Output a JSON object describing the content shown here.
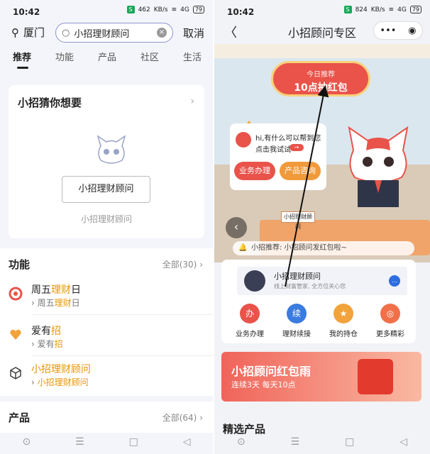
{
  "left": {
    "status": {
      "time": "10:42",
      "data_rate": "462",
      "data_unit": "KB/s",
      "signal": "4G",
      "battery": "79"
    },
    "location": "厦门",
    "search": {
      "value": "小招理财顾问",
      "clear": "×"
    },
    "cancel": "取消",
    "tabs": [
      "推荐",
      "功能",
      "产品",
      "社区",
      "生活"
    ],
    "guess": {
      "title": "小招猜你想要",
      "chevron": "›",
      "button": "小招理财顾问",
      "subtitle": "小招理财顾问"
    },
    "functions": {
      "title": "功能",
      "all": "全部(30)",
      "items": [
        {
          "name_pre": "周五",
          "name_hl": "理财",
          "name_post": "日",
          "sub_pre": "› 周五",
          "sub_hl": "理财",
          "sub_post": "日"
        },
        {
          "name_pre": "爱有",
          "name_hl": "招",
          "name_post": "",
          "sub_pre": "› 爱有",
          "sub_hl": "招",
          "sub_post": ""
        },
        {
          "name_pre": "",
          "name_hl": "小招理财顾问",
          "name_post": "",
          "sub_pre": "› ",
          "sub_hl": "小招理财顾问",
          "sub_post": ""
        }
      ]
    },
    "products": {
      "title": "产品",
      "all": "全部(64)"
    }
  },
  "right": {
    "status": {
      "time": "10:42",
      "data_rate": "824",
      "data_unit": "KB/s",
      "signal": "4G",
      "battery": "79"
    },
    "back": "〈",
    "title": "小招顾问专区",
    "menu": "•••",
    "close": "◉",
    "badge": {
      "top": "今日推荐",
      "main": "10点抽红包"
    },
    "bubble": {
      "greeting": "hi,有什么可以帮到您",
      "try": "点击我试试",
      "btn1": "业务办理",
      "btn2": "产品咨询"
    },
    "plaque": "小招理财顾问",
    "notice": "小招推荐: 小招顾问发红包啦~",
    "advisor": {
      "name": "小招理财顾问",
      "desc": "线上财富管家, 全方位关心您"
    },
    "quick": [
      {
        "label": "业务办理",
        "color": "#e9534a",
        "glyph": "办"
      },
      {
        "label": "理财续接",
        "color": "#3a7be0",
        "glyph": "续"
      },
      {
        "label": "我的持仓",
        "color": "#f2a33c",
        "glyph": "★"
      },
      {
        "label": "更多精彩",
        "color": "#f0704a",
        "glyph": "◎"
      }
    ],
    "promo": {
      "title": "小招顾问红包雨",
      "subtitle": "连续3天  每天10点"
    },
    "next_section": "精选产品"
  },
  "nav": [
    "⊙",
    "☰",
    "□",
    "◁"
  ],
  "colors": {
    "highlight": "#e69500",
    "brand_red": "#e9534a",
    "search_border": "#8d93c9"
  }
}
